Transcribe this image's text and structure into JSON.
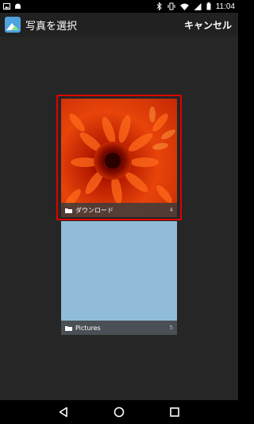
{
  "status_bar": {
    "time": "11:04",
    "icons": [
      "image-notification-icon",
      "android-notification-icon",
      "bluetooth-icon",
      "vibrate-icon",
      "wifi-icon",
      "signal-icon",
      "battery-icon"
    ]
  },
  "app_bar": {
    "title": "写真を選択",
    "cancel_label": "キャンセル",
    "app_icon": "photos-app-icon"
  },
  "albums": [
    {
      "name": "ダウンロード",
      "count": "4",
      "selected": true,
      "thumbnail": "red-chrysanthemum"
    },
    {
      "name": "Pictures",
      "count": "5",
      "selected": false,
      "thumbnail": "solid-light-blue"
    }
  ],
  "nav_bar": {
    "buttons": [
      "back-icon",
      "home-icon",
      "recents-icon"
    ]
  },
  "colors": {
    "highlight": "#e00000",
    "background": "#262626",
    "app_bar": "#212121",
    "pictures_thumb": "#91bcd9"
  }
}
